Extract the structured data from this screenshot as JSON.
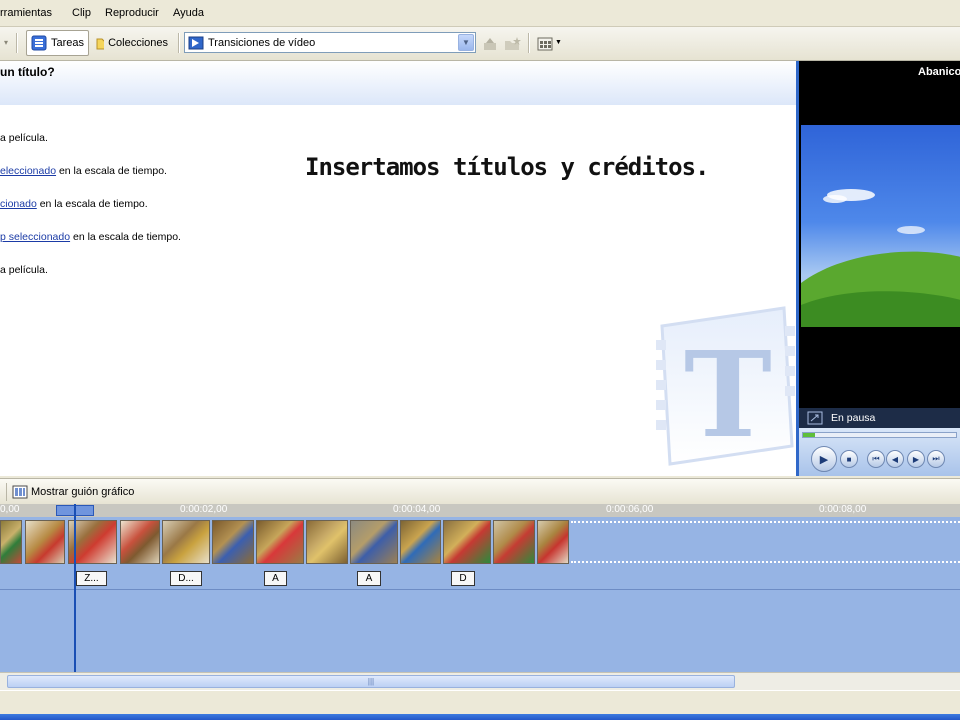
{
  "menu": {
    "items": [
      "rramientas",
      "Clip",
      "Reproducir",
      "Ayuda"
    ]
  },
  "toolbar": {
    "tasks_label": "Tareas",
    "collections_label": "Colecciones",
    "dropdown_value": "Transiciones de vídeo"
  },
  "main": {
    "question": "un título?",
    "lines": [
      {
        "link": "",
        "text": "a película."
      },
      {
        "link": "eleccionado",
        "text": " en la escala de tiempo."
      },
      {
        "link": "cionado",
        "text": " en la escala de tiempo."
      },
      {
        "link": "p seleccionado",
        "text": " en la escala de tiempo."
      },
      {
        "link": "",
        "text": "a película."
      }
    ],
    "caption": "Insertamos títulos y créditos."
  },
  "player": {
    "title": "Abanico",
    "status": "En pausa"
  },
  "storyboard": {
    "show_storyboard_label": "Mostrar guión gráfico",
    "ruler_ticks": [
      "0,00",
      "0:00:02,00",
      "0:00:04,00",
      "0:00:06,00",
      "0:00:08,00"
    ],
    "transitions": [
      "Z...",
      "D...",
      "A",
      "A",
      "D"
    ]
  },
  "colors": {
    "accent": "#3068c9",
    "timeline": "#96b4e4"
  }
}
